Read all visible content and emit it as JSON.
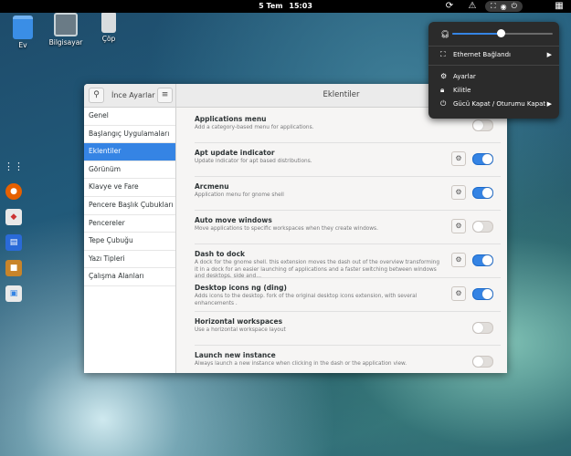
{
  "topbar": {
    "date": "5 Tem",
    "time": "15:03",
    "icons": [
      "refresh-icon",
      "warning-icon",
      "network-icon",
      "accessibility-icon",
      "power-icon",
      "window-icon"
    ]
  },
  "desktop": [
    {
      "label": "Ev",
      "icon": "home-folder-icon"
    },
    {
      "label": "Bilgisayar",
      "icon": "computer-icon"
    },
    {
      "label": "Çöp",
      "icon": "trash-icon"
    }
  ],
  "dock": [
    "app-grid-icon",
    "firefox-icon",
    "software-icon",
    "document-icon",
    "package-icon",
    "files-icon"
  ],
  "window": {
    "app_title": "İnce Ayarlar",
    "main_title": "Eklentiler",
    "sidebar": [
      {
        "label": "Genel"
      },
      {
        "label": "Başlangıç Uygulamaları"
      },
      {
        "label": "Eklentiler"
      },
      {
        "label": "Görünüm"
      },
      {
        "label": "Klavye ve Fare"
      },
      {
        "label": "Pencere Başlık Çubukları"
      },
      {
        "label": "Pencereler"
      },
      {
        "label": "Tepe Çubuğu"
      },
      {
        "label": "Yazı Tipleri"
      },
      {
        "label": "Çalışma Alanları"
      }
    ],
    "active_index": 2,
    "extensions": [
      {
        "name": "Applications menu",
        "desc": "Add a category-based menu for applications.",
        "enabled": false,
        "settings": false
      },
      {
        "name": "Apt update indicator",
        "desc": "Update indicator for apt based distributions.",
        "enabled": true,
        "settings": true
      },
      {
        "name": "Arcmenu",
        "desc": "Application menu for gnome shell",
        "enabled": true,
        "settings": true
      },
      {
        "name": "Auto move windows",
        "desc": "Move applications to specific workspaces when they create windows.",
        "enabled": false,
        "settings": true
      },
      {
        "name": "Dash to dock",
        "desc": "A dock for the gnome shell. this extension moves the dash out of the overview transforming it in a dock for an easier launching of applications and a faster switching between windows and desktops. side and…",
        "enabled": true,
        "settings": true
      },
      {
        "name": "Desktop icons ng (ding)",
        "desc": "Adds icons to the desktop. fork of the original desktop icons extension, with several enhancements .",
        "enabled": true,
        "settings": true
      },
      {
        "name": "Horizontal workspaces",
        "desc": "Use a horizontal workspace layout",
        "enabled": false,
        "settings": false
      },
      {
        "name": "Launch new instance",
        "desc": "Always launch a new instance when clicking in the dash or the application view.",
        "enabled": false,
        "settings": false
      }
    ]
  },
  "system_menu": {
    "volume_level": 0.48,
    "items": [
      {
        "label": "Ethernet Bağlandı",
        "icon": "network-wired-icon",
        "submenu": true
      },
      {
        "label": "Ayarlar",
        "icon": "settings-icon",
        "submenu": false
      },
      {
        "label": "Kilitle",
        "icon": "lock-icon",
        "submenu": false
      },
      {
        "label": "Gücü Kapat / Oturumu Kapat",
        "icon": "power-icon",
        "submenu": true
      }
    ]
  },
  "colors": {
    "accent": "#3584e4",
    "menu_bg": "#2b2b2b"
  }
}
